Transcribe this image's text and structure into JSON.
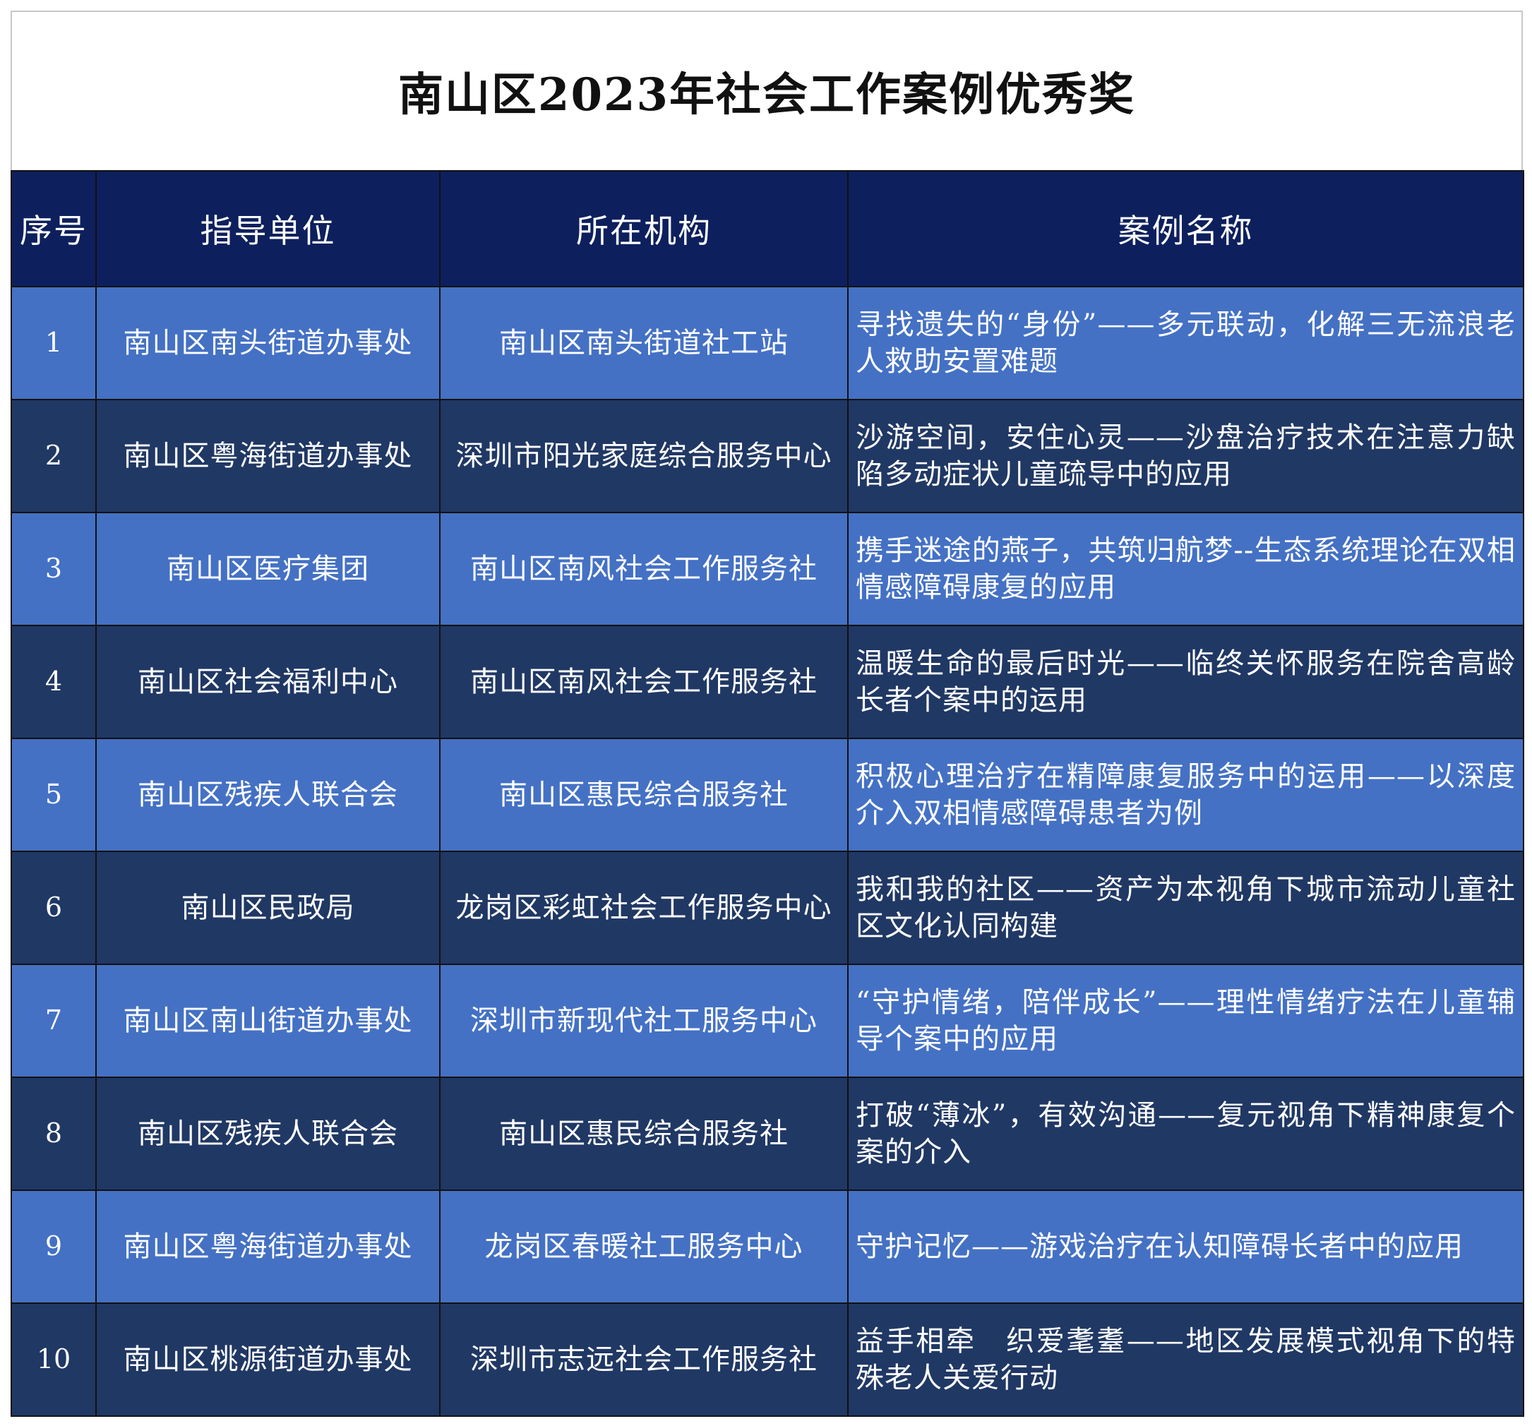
{
  "title": "南山区2023年社会工作案例优秀奖",
  "columns": [
    "序号",
    "指导单位",
    "所在机构",
    "案例名称"
  ],
  "rows": [
    {
      "no": "1",
      "unit": "南山区南头街道办事处",
      "org": "南山区南头街道社工站",
      "name": "寻找遗失的“身份”——多元联动，化解三无流浪老人救助安置难题"
    },
    {
      "no": "2",
      "unit": "南山区粤海街道办事处",
      "org": "深圳市阳光家庭综合服务中心",
      "name": "沙游空间，安住心灵——沙盘治疗技术在注意力缺陷多动症状儿童疏导中的应用"
    },
    {
      "no": "3",
      "unit": "南山区医疗集团",
      "org": "南山区南风社会工作服务社",
      "name": "携手迷途的燕子，共筑归航梦--生态系统理论在双相情感障碍康复的应用"
    },
    {
      "no": "4",
      "unit": "南山区社会福利中心",
      "org": "南山区南风社会工作服务社",
      "name": "温暖生命的最后时光——临终关怀服务在院舍高龄长者个案中的运用"
    },
    {
      "no": "5",
      "unit": "南山区残疾人联合会",
      "org": "南山区惠民综合服务社",
      "name": "积极心理治疗在精障康复服务中的运用——以深度介入双相情感障碍患者为例"
    },
    {
      "no": "6",
      "unit": "南山区民政局",
      "org": "龙岗区彩虹社会工作服务中心",
      "name": "我和我的社区——资产为本视角下城市流动儿童社区文化认同构建"
    },
    {
      "no": "7",
      "unit": "南山区南山街道办事处",
      "org": "深圳市新现代社工服务中心",
      "name": "“守护情绪，陪伴成长”——理性情绪疗法在儿童辅导个案中的应用"
    },
    {
      "no": "8",
      "unit": "南山区残疾人联合会",
      "org": "南山区惠民综合服务社",
      "name": "打破“薄冰”，有效沟通——复元视角下精神康复个案的介入"
    },
    {
      "no": "9",
      "unit": "南山区粤海街道办事处",
      "org": "龙岗区春暖社工服务中心",
      "name": "守护记忆——游戏治疗在认知障碍长者中的应用"
    },
    {
      "no": "10",
      "unit": "南山区桃源街道办事处",
      "org": "深圳市志远社会工作服务社",
      "name": "益手相牵　织爱耄耋——地区发展模式视角下的特殊老人关爱行动"
    }
  ]
}
